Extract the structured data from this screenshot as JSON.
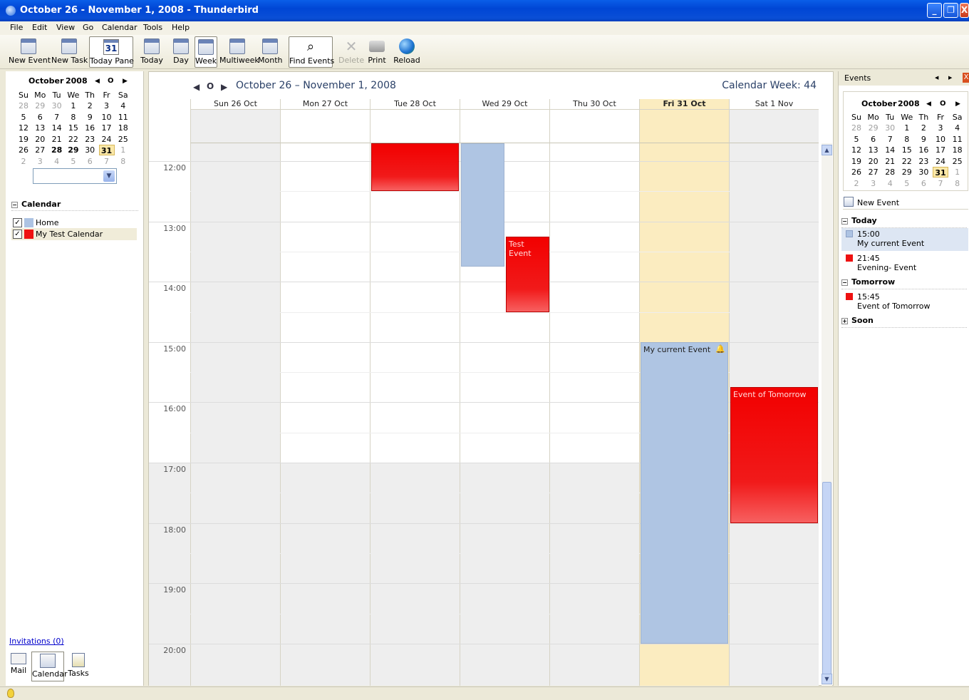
{
  "window": {
    "title": "October 26 - November 1, 2008 - Thunderbird",
    "minimize": "_",
    "restore": "❐",
    "close": "X"
  },
  "menu": [
    "File",
    "Edit",
    "View",
    "Go",
    "Calendar",
    "Tools",
    "Help"
  ],
  "toolbar": {
    "new_event": "New Event",
    "new_task": "New Task",
    "today_pane": "Today Pane",
    "today_pane_icon": "31",
    "today": "Today",
    "day": "Day",
    "week": "Week",
    "multiweek": "Multiweek",
    "month": "Month",
    "find_events": "Find Events",
    "delete": "Delete",
    "print": "Print",
    "reload": "Reload"
  },
  "left_minimonth": {
    "month": "October",
    "year": "2008",
    "prev": "◀",
    "today": "O",
    "next": "▶",
    "weekdays": [
      "Su",
      "Mo",
      "Tu",
      "We",
      "Th",
      "Fr",
      "Sa"
    ],
    "weeks": [
      [
        "28",
        "29",
        "30",
        "1",
        "2",
        "3",
        "4"
      ],
      [
        "5",
        "6",
        "7",
        "8",
        "9",
        "10",
        "11"
      ],
      [
        "12",
        "13",
        "14",
        "15",
        "16",
        "17",
        "18"
      ],
      [
        "19",
        "20",
        "21",
        "22",
        "23",
        "24",
        "25"
      ],
      [
        "26",
        "27",
        "28",
        "29",
        "30",
        "31",
        "1"
      ],
      [
        "2",
        "3",
        "4",
        "5",
        "6",
        "7",
        "8"
      ]
    ]
  },
  "calendar_list": {
    "title": "Calendar",
    "toggle": "−",
    "items": [
      {
        "name": "Home",
        "color": "#adc3e3",
        "checked": "✓"
      },
      {
        "name": "My Test Calendar",
        "color": "#ee1111",
        "checked": "✓"
      }
    ]
  },
  "invitations": "Invitations (0)",
  "modes": {
    "mail": "Mail",
    "calendar": "Calendar",
    "tasks": "Tasks"
  },
  "week_view": {
    "prev": "◀",
    "today": "O",
    "next": "▶",
    "title": "October 26 – November 1, 2008",
    "week_label": "Calendar Week: 44",
    "days": [
      "Sun 26 Oct",
      "Mon 27 Oct",
      "Tue 28 Oct",
      "Wed 29 Oct",
      "Thu 30 Oct",
      "Fri 31 Oct",
      "Sat 1 Nov"
    ],
    "hours": [
      "12:00",
      "13:00",
      "14:00",
      "15:00",
      "16:00",
      "17:00",
      "18:00",
      "19:00",
      "20:00"
    ],
    "events": [
      {
        "title": "",
        "day": "Tue 28 Oct",
        "start": "11:40",
        "end": "12:30",
        "calendar": "My Test Calendar"
      },
      {
        "title": "",
        "day": "Wed 29 Oct",
        "start": "11:40",
        "end": "13:45",
        "calendar": "Home"
      },
      {
        "title": "Test Event",
        "day": "Wed 29 Oct",
        "start": "13:15",
        "end": "14:30",
        "calendar": "My Test Calendar"
      },
      {
        "title": "My current Event",
        "day": "Fri 31 Oct",
        "start": "15:00",
        "end": "20:00",
        "calendar": "Home",
        "alarm": "🔔"
      },
      {
        "title": "Event of Tomorrow",
        "day": "Sat 1 Nov",
        "start": "15:45",
        "end": "18:00",
        "calendar": "My Test Calendar"
      }
    ],
    "scroll_up": "▲",
    "scroll_down": "▼"
  },
  "today_pane": {
    "header": "Events",
    "prev": "◀",
    "next": "▶",
    "close": "X",
    "month": "October",
    "year": "2008",
    "weekdays": [
      "Su",
      "Mo",
      "Tu",
      "We",
      "Th",
      "Fr",
      "Sa"
    ],
    "weeks": [
      [
        "28",
        "29",
        "30",
        "1",
        "2",
        "3",
        "4"
      ],
      [
        "5",
        "6",
        "7",
        "8",
        "9",
        "10",
        "11"
      ],
      [
        "12",
        "13",
        "14",
        "15",
        "16",
        "17",
        "18"
      ],
      [
        "19",
        "20",
        "21",
        "22",
        "23",
        "24",
        "25"
      ],
      [
        "26",
        "27",
        "28",
        "29",
        "30",
        "31",
        "1"
      ],
      [
        "2",
        "3",
        "4",
        "5",
        "6",
        "7",
        "8"
      ]
    ],
    "new_event": "New Event",
    "today_label": "Today",
    "tomorrow_label": "Tomorrow",
    "soon_label": "Soon",
    "today_items": [
      {
        "time": "15:00",
        "title": "My current Event",
        "color": "#adc3e3"
      },
      {
        "time": "21:45",
        "title": "Evening- Event",
        "color": "#ee1111"
      }
    ],
    "tomorrow_items": [
      {
        "time": "15:45",
        "title": "Event of Tomorrow",
        "color": "#ee1111"
      }
    ],
    "collapse": "−",
    "expand": "+"
  },
  "colors": {
    "today_column": "#fbecc0",
    "selected_day": "#fbe8a8",
    "home": "#adc3e3",
    "test": "#ee1111"
  }
}
